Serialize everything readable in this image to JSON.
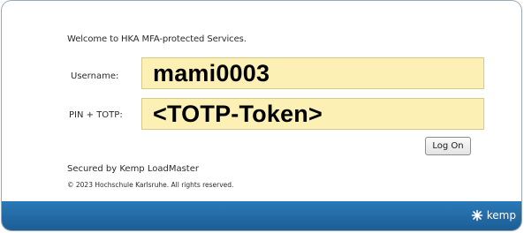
{
  "login": {
    "welcome_text": "Welcome to HKA MFA-protected Services.",
    "username_label": "Username:",
    "username_value": "mami0003",
    "pin_label": "PIN + TOTP:",
    "pin_value": "<TOTP-Token>",
    "logon_button_label": "Log On"
  },
  "footer": {
    "secured_text": "Secured by Kemp LoadMaster",
    "copyright_text": "© 2023 Hochschule Karlsruhe. All rights reserved.",
    "brand_name": "kemp",
    "brand_icon": "kemp-logo-icon"
  },
  "colors": {
    "input_background": "#fdf0b5",
    "footer_bar": "#2a79b8"
  }
}
